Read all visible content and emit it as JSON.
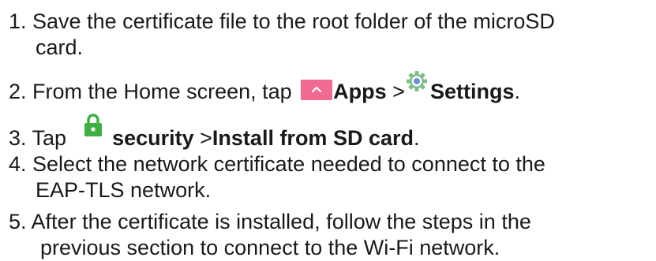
{
  "steps": [
    {
      "num": "1.",
      "line1": " Save the certificate file to the root folder of the microSD",
      "line2": "card."
    },
    {
      "num": "2.",
      "lead": " From the Home screen, tap ",
      "apps": "Apps",
      "sep": " >",
      "settings": "Settings",
      "trail": "."
    },
    {
      "num": "3.",
      "lead": " Tap",
      "security": "security",
      "sep": " >",
      "install": "Install from SD card",
      "trail": "."
    },
    {
      "num": "4.",
      "line1": " Select the network certificate needed to connect to the",
      "line2": "EAP-TLS network."
    },
    {
      "num": "5.",
      "line1": " After the certificate is installed, follow the steps in the",
      "line2": "previous section to connect to the Wi-Fi network."
    }
  ],
  "icons": {
    "apps": "apps-icon",
    "settings": "gear-icon",
    "security": "lock-icon"
  },
  "colors": {
    "apps_tile": "#f06a92",
    "settings_icon": "#7cbf86",
    "lock_icon": "#3fae43",
    "text": "#1a1a1a"
  }
}
